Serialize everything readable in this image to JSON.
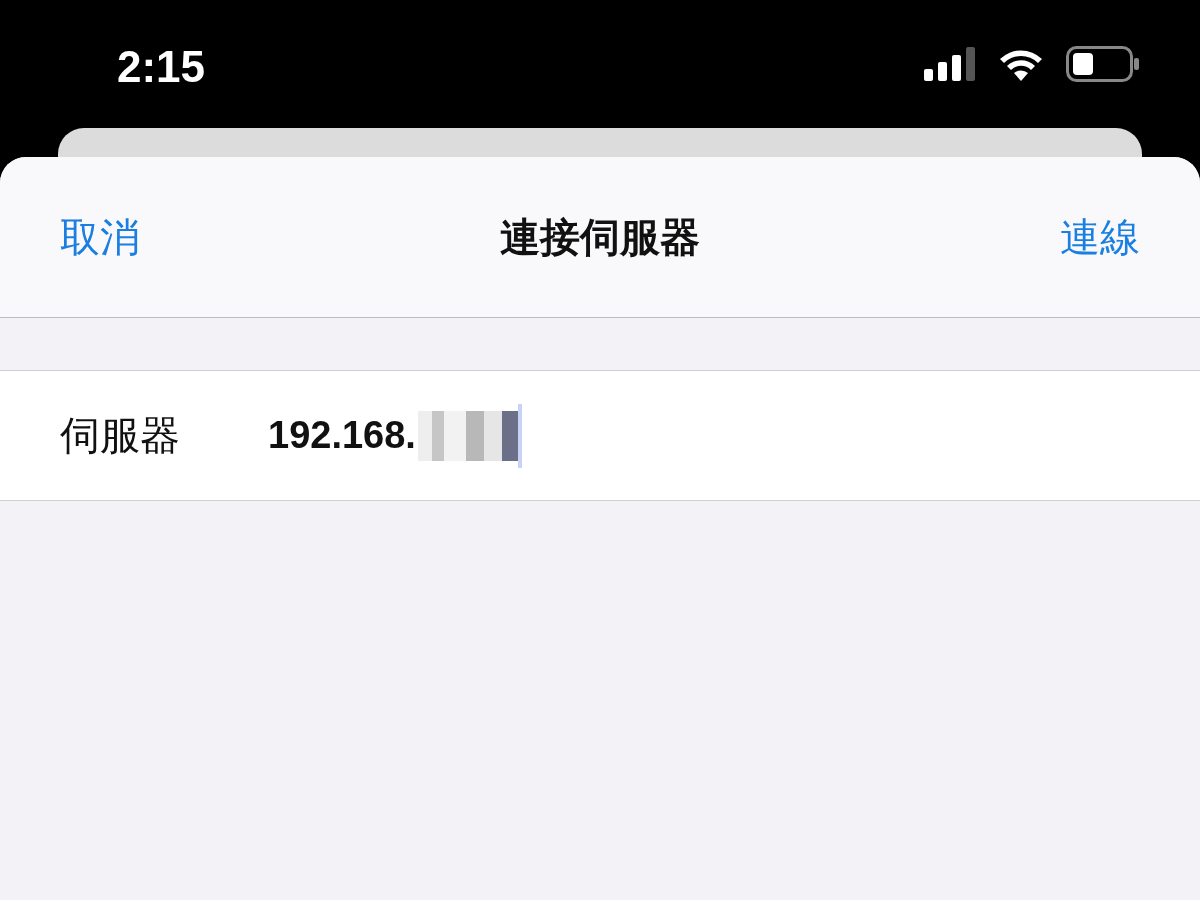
{
  "status_bar": {
    "time": "2:15"
  },
  "nav_bar": {
    "cancel": "取消",
    "title": "連接伺服器",
    "connect": "連線"
  },
  "form": {
    "rows": [
      {
        "label": "伺服器",
        "value": "192.168."
      }
    ]
  }
}
